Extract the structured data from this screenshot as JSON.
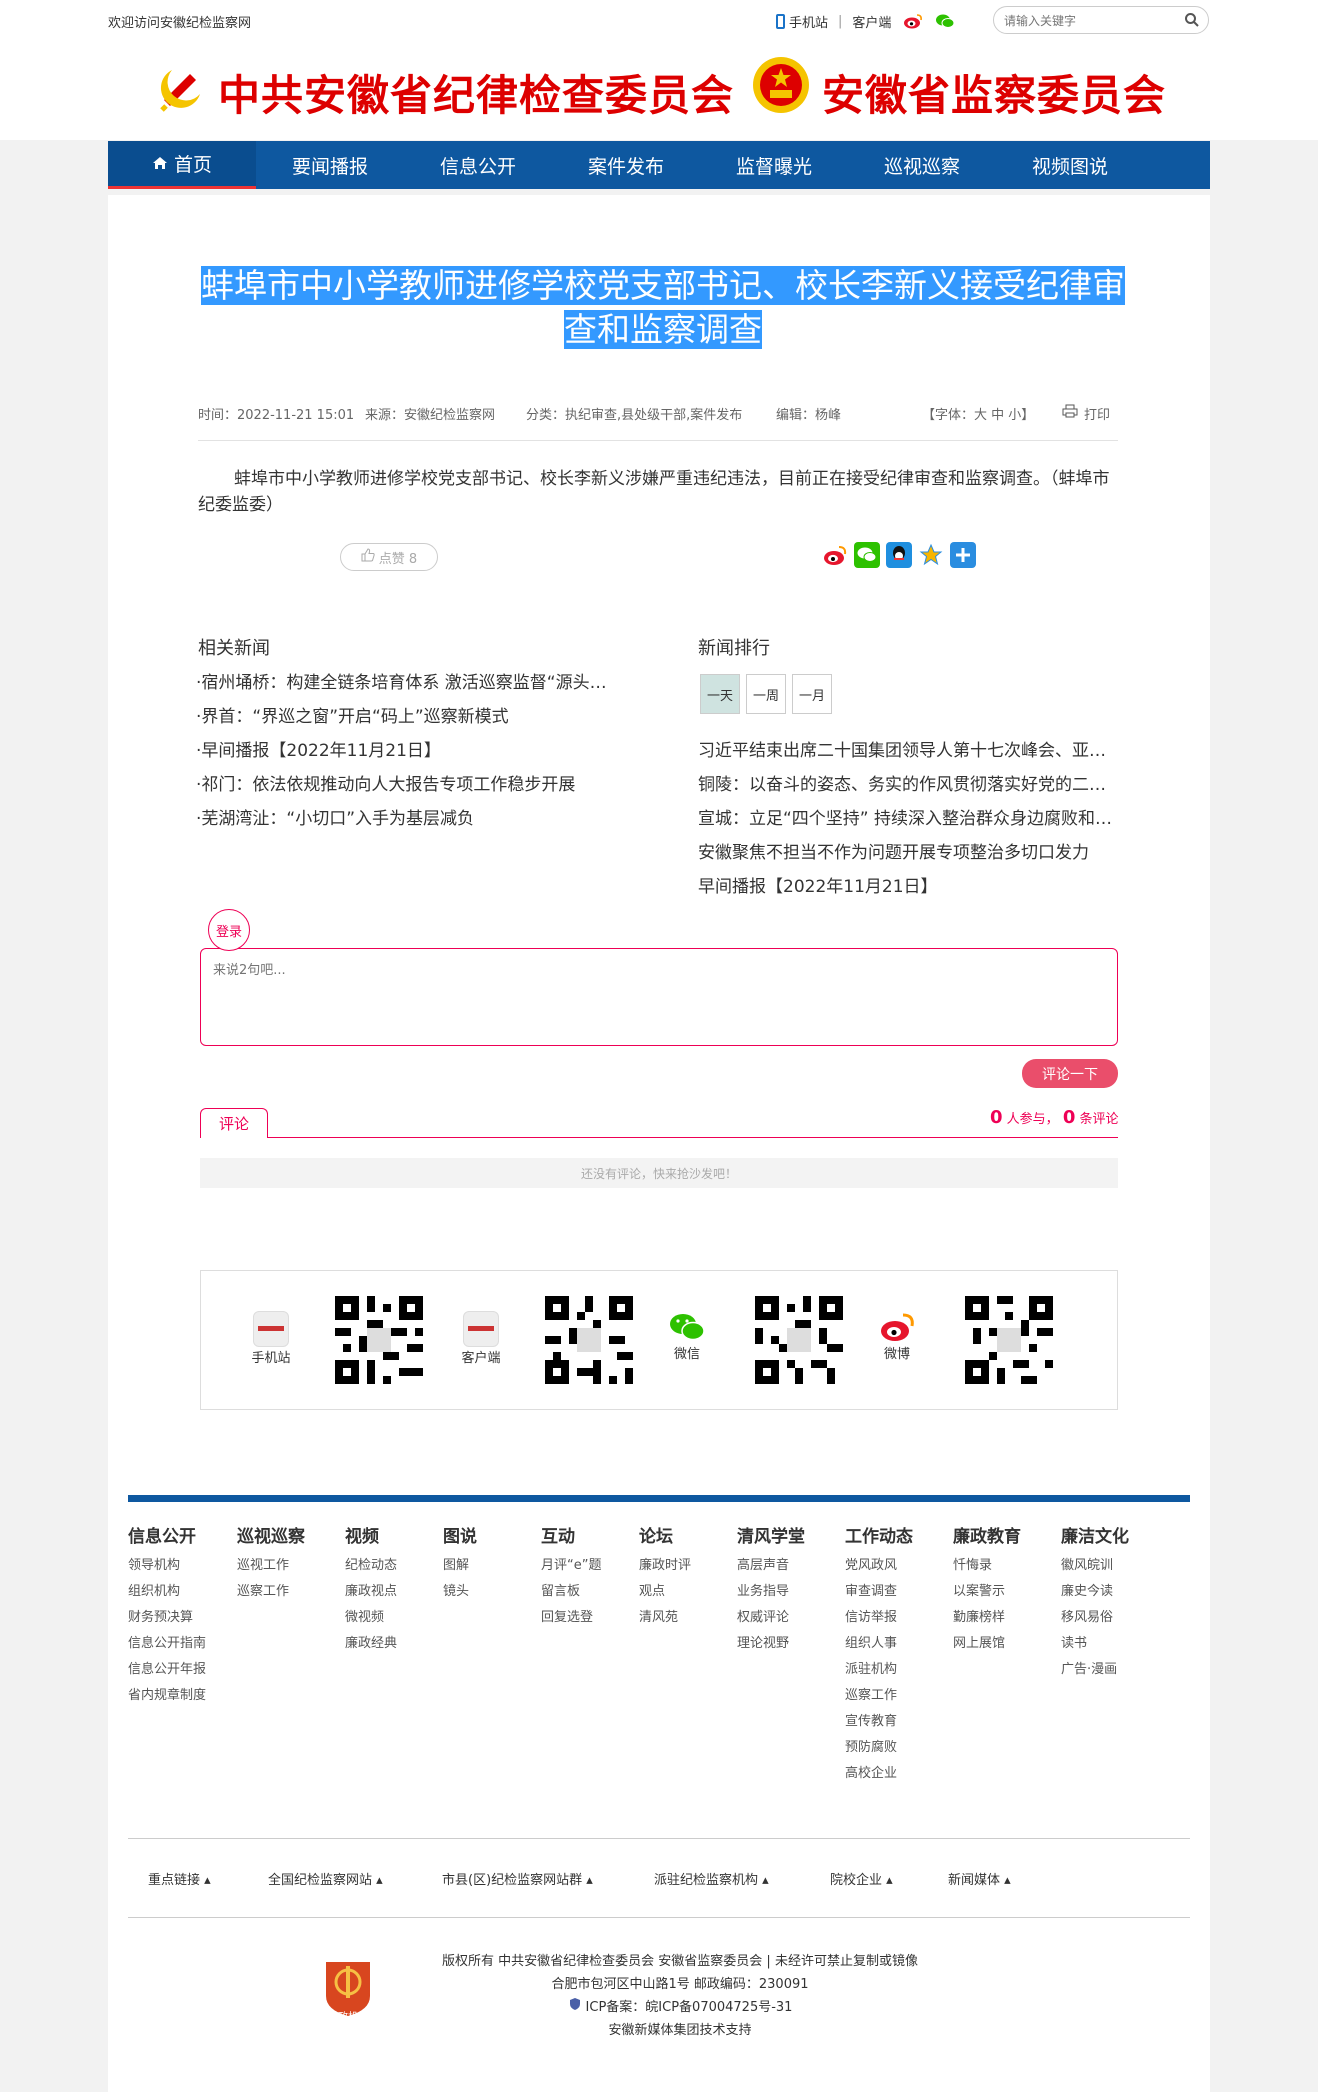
{
  "topbar": {
    "welcome": "欢迎访问安徽纪检监察网",
    "mobile": "手机站",
    "client": "客户端",
    "search_placeholder": "请输入关键字"
  },
  "header": {
    "left_title": "中共安徽省纪律检查委员会",
    "right_title": "安徽省监察委员会"
  },
  "nav": [
    "首页",
    "要闻播报",
    "信息公开",
    "案件发布",
    "监督曝光",
    "巡视巡察",
    "视频图说"
  ],
  "article": {
    "title": "蚌埠市中小学教师进修学校党支部书记、校长李新义接受纪律审查和监察调查",
    "time": "时间：2022-11-21 15:01",
    "source": "来源：安徽纪检监察网",
    "category": "分类：执纪审查,县处级干部,案件发布",
    "editor": "编辑：杨峰",
    "fontsize": "【字体：大 中 小】",
    "print": "打印",
    "body": "蚌埠市中小学教师进修学校党支部书记、校长李新义涉嫌严重违纪违法，目前正在接受纪律审查和监察调查。（蚌埠市纪委监委）",
    "like": "点赞 8"
  },
  "related": {
    "title": "相关新闻",
    "items": [
      "·宿州埇桥：构建全链条培育体系 激活巡察监督“源头活水”",
      "·界首：“界巡之窗”开启“码上”巡察新模式",
      "·早间播报【2022年11月21日】",
      "·祁门：依法依规推动向人大报告专项工作稳步开展",
      "·芜湖湾沚：“小切口”入手为基层减负"
    ]
  },
  "ranking": {
    "title": "新闻排行",
    "tabs": [
      "一天",
      "一周",
      "一月"
    ],
    "items": [
      "习近平结束出席二十国集团领导人第十七次峰会、亚太经合组织第二十九次领导人非正式会议",
      "铜陵：以奋斗的姿态、务实的作风贯彻落实好党的二十大精神",
      "宣城：立足“四个坚持” 持续深入整治群众身边腐败和作风问题",
      "安徽聚焦不担当不作为问题开展专项整治多切口发力",
      "早间播报【2022年11月21日】"
    ]
  },
  "comment": {
    "login": "登录",
    "placeholder": "来说2句吧...",
    "submit": "评论一下",
    "tab": "评论",
    "participants": "0",
    "participants_label": "人参与，",
    "count": "0",
    "count_label": "条评论",
    "empty": "还没有评论，快来抢沙发吧！"
  },
  "qr": {
    "mobile": "手机站",
    "client": "客户端",
    "wechat": "微信",
    "weibo": "微博"
  },
  "footer_cols": [
    {
      "h": "信息公开",
      "l": [
        "领导机构",
        "组织机构",
        "财务预决算",
        "信息公开指南",
        "信息公开年报",
        "省内规章制度"
      ]
    },
    {
      "h": "巡视巡察",
      "l": [
        "巡视工作",
        "巡察工作"
      ]
    },
    {
      "h": "视频",
      "l": [
        "纪检动态",
        "廉政视点",
        "微视频",
        "廉政经典"
      ]
    },
    {
      "h": "图说",
      "l": [
        "图解",
        "镜头"
      ]
    },
    {
      "h": "互动",
      "l": [
        "月评“e”题",
        "留言板",
        "回复选登"
      ]
    },
    {
      "h": "论坛",
      "l": [
        "廉政时评",
        "观点",
        "清风苑"
      ]
    },
    {
      "h": "清风学堂",
      "l": [
        "高层声音",
        "业务指导",
        "权威评论",
        "理论视野"
      ]
    },
    {
      "h": "工作动态",
      "l": [
        "党风政风",
        "审查调查",
        "信访举报",
        "组织人事",
        "派驻机构",
        "巡察工作",
        "宣传教育",
        "预防腐败",
        "高校企业"
      ]
    },
    {
      "h": "廉政教育",
      "l": [
        "忏悔录",
        "以案警示",
        "勤廉榜样",
        "网上展馆"
      ]
    },
    {
      "h": "廉洁文化",
      "l": [
        "徽风皖训",
        "廉史今读",
        "移风易俗",
        "读书",
        "广告·漫画"
      ]
    }
  ],
  "links": [
    "重点链接",
    "全国纪检监察网站",
    "市县(区)纪检监察网站群",
    "派驻纪检监察机构",
    "院校企业",
    "新闻媒体"
  ],
  "copyright": {
    "line1": "版权所有   中共安徽省纪律检查委员会  安徽省监察委员会  |  未经许可禁止复制或镜像",
    "line2": "合肥市包河区中山路1号   邮政编码：230091",
    "line3": "ICP备案：皖ICP备07004725号-31",
    "line4": "安徽新媒体集团技术支持",
    "badge": "党政机关"
  },
  "colors": {
    "nav": "#0e58a0",
    "brand_red": "#dd0000",
    "comment_pink": "#ea4e6b"
  }
}
